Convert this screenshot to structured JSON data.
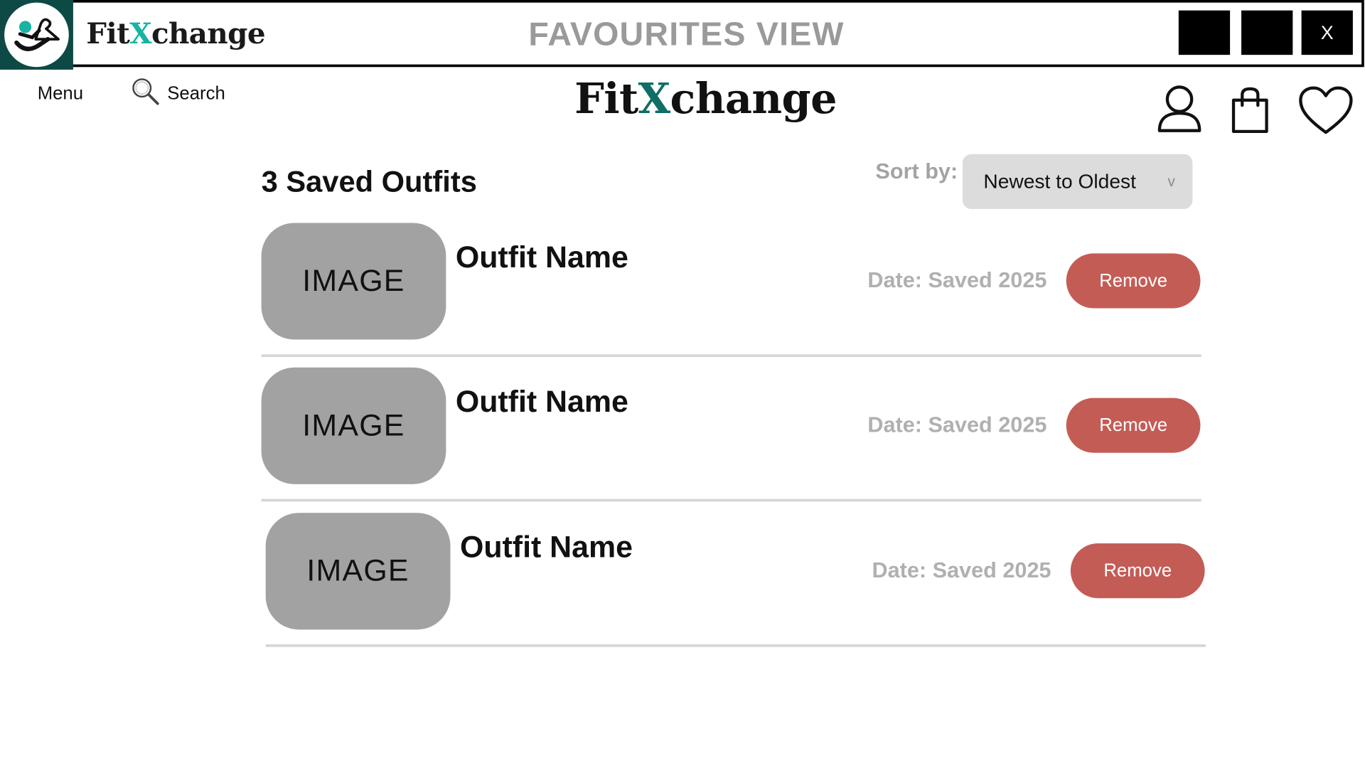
{
  "window": {
    "app_name_prefix": "Fit",
    "app_name_x": "X",
    "app_name_suffix": "change",
    "title": "FAVOURITES VIEW",
    "close_label": "X"
  },
  "header": {
    "menu_label": "Menu",
    "search_label": "Search",
    "brand_prefix": "Fit",
    "brand_x": "X",
    "brand_suffix": "change"
  },
  "favourites": {
    "count_title": "3 Saved Outfits",
    "sort_label": "Sort by:",
    "sort_value": "Newest to Oldest",
    "sort_chevron": "v",
    "items": [
      {
        "image_label": "IMAGE",
        "name": "Outfit Name",
        "date": "Date: Saved 2025",
        "remove_label": "Remove"
      },
      {
        "image_label": "IMAGE",
        "name": "Outfit Name",
        "date": "Date: Saved 2025",
        "remove_label": "Remove"
      },
      {
        "image_label": "IMAGE",
        "name": "Outfit Name",
        "date": "Date: Saved 2025",
        "remove_label": "Remove"
      }
    ]
  },
  "colors": {
    "brand_teal": "#19b3a3",
    "brand_dark_teal": "#0f6e66",
    "remove_button": "#c45c56",
    "thumb_gray": "#a2a2a2"
  },
  "icons": [
    "app-logo-icon",
    "search-icon",
    "user-icon",
    "shopping-bag-icon",
    "heart-icon"
  ]
}
